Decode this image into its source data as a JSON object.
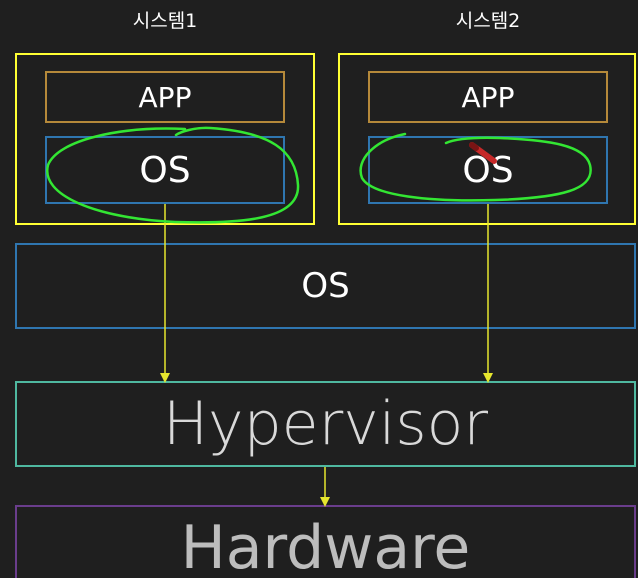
{
  "systems": [
    {
      "title": "시스템1",
      "app_label": "APP",
      "os_label": "OS"
    },
    {
      "title": "시스템2",
      "app_label": "APP",
      "os_label": "OS"
    }
  ],
  "host_os": {
    "label": "OS"
  },
  "hypervisor": {
    "label": "Hypervisor"
  },
  "hardware": {
    "label": "Hardware"
  },
  "colors": {
    "background": "#1f1f1f",
    "system_border": "#ffff33",
    "app_border": "#b5893a",
    "os_border": "#2f76b0",
    "hypervisor_border": "#4fb8a0",
    "hardware_border": "#6a3d8c",
    "arrow": "#e6e62e",
    "highlight": "#33e633",
    "text": "#ffffff"
  }
}
